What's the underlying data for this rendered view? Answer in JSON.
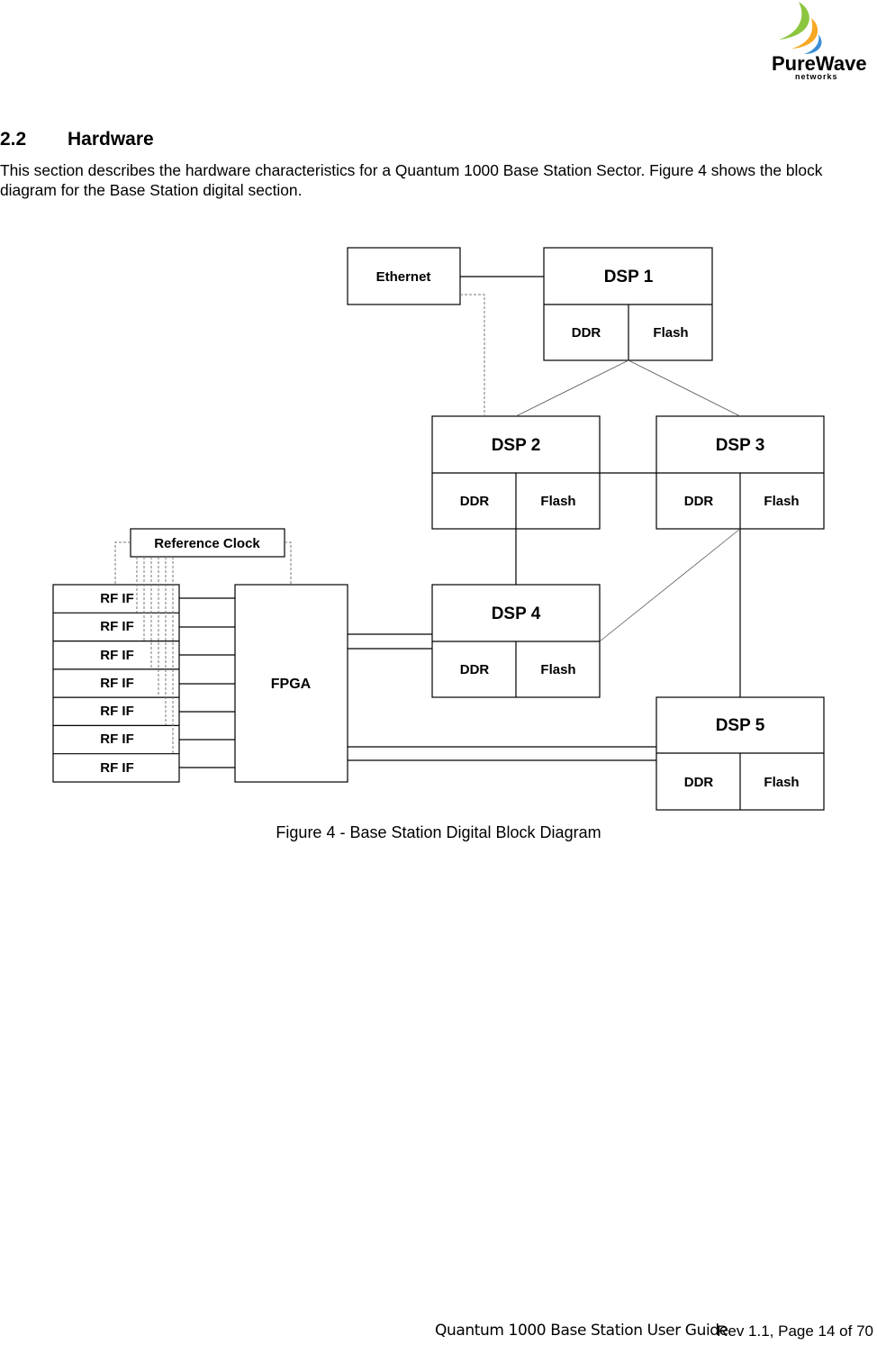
{
  "header": {
    "logo": {
      "name": "PureWave",
      "sub": "networks",
      "colors": {
        "green": "#8cc63f",
        "orange": "#f7a823",
        "blue": "#3a8fd6",
        "text": "#3c3c3c"
      }
    }
  },
  "section": {
    "number": "2.2",
    "title": "Hardware",
    "body": "This section describes the hardware characteristics for a Quantum 1000 Base Station Sector. Figure 4 shows the block diagram for the Base Station digital section."
  },
  "diagram": {
    "ethernet": "Ethernet",
    "reference_clock": "Reference Clock",
    "fpga": "FPGA",
    "rf_if": [
      "RF IF",
      "RF IF",
      "RF IF",
      "RF IF",
      "RF IF",
      "RF IF",
      "RF IF"
    ],
    "dsps": [
      {
        "name": "DSP 1",
        "mem1": "DDR",
        "mem2": "Flash"
      },
      {
        "name": "DSP 2",
        "mem1": "DDR",
        "mem2": "Flash"
      },
      {
        "name": "DSP 3",
        "mem1": "DDR",
        "mem2": "Flash"
      },
      {
        "name": "DSP 4",
        "mem1": "DDR",
        "mem2": "Flash"
      },
      {
        "name": "DSP 5",
        "mem1": "DDR",
        "mem2": "Flash"
      }
    ]
  },
  "caption": "Figure 4 - Base Station Digital Block Diagram",
  "footer": {
    "doc_title": "Quantum 1000 Base Station User Guide",
    "page_info": "Rev 1.1, Page 14 of 70"
  }
}
